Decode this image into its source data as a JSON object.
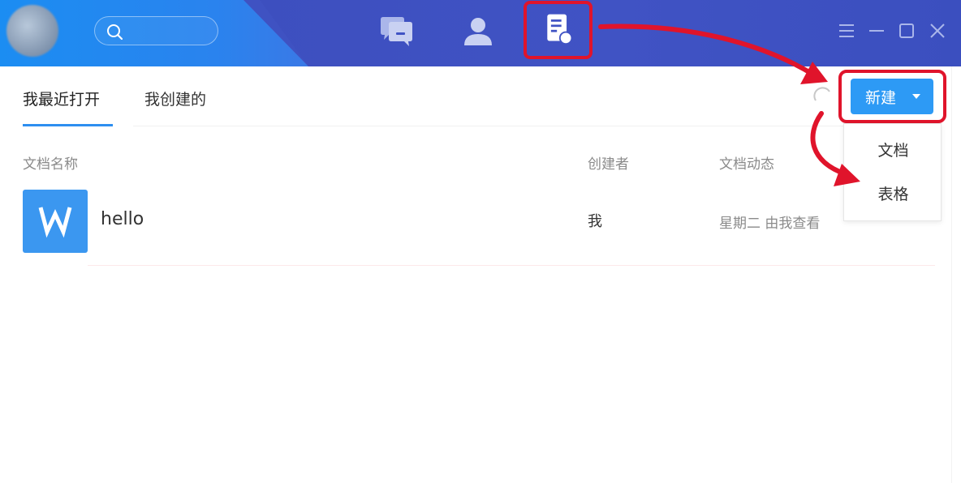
{
  "colors": {
    "titlebar": "#3f52c2",
    "accent": "#2d9af5",
    "annotation": "#e0142b",
    "file_icon": "#3b97f0"
  },
  "titlebar": {
    "search_icon": "search-icon",
    "nav": [
      "chat-icon",
      "contacts-icon",
      "docs-icon"
    ],
    "window_controls": [
      "menu-icon",
      "minimize-icon",
      "maximize-icon",
      "close-icon"
    ]
  },
  "tabs": [
    {
      "label": "我最近打开",
      "active": true
    },
    {
      "label": "我创建的",
      "active": false
    }
  ],
  "new_button": {
    "label": "新建"
  },
  "dropdown": {
    "items": [
      {
        "label": "文档"
      },
      {
        "label": "表格"
      }
    ]
  },
  "table": {
    "headers": {
      "name": "文档名称",
      "creator": "创建者",
      "activity": "文档动态"
    },
    "rows": [
      {
        "icon": "word-doc-icon",
        "name": "hello",
        "creator": "我",
        "activity": "星期二 由我查看"
      }
    ]
  }
}
